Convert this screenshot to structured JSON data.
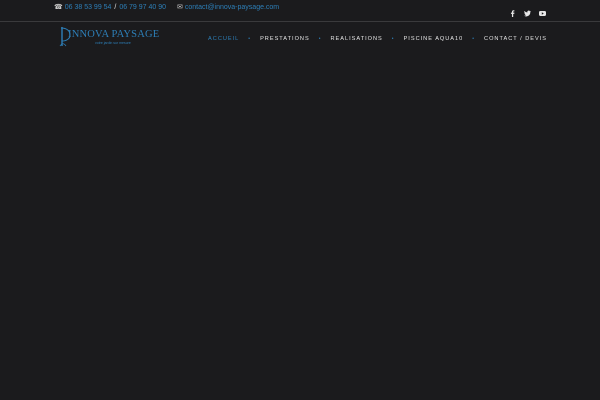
{
  "topbar": {
    "phone_icon": "phone-icon",
    "phone_1": "06 38 53 99 54",
    "phone_separator": "/",
    "phone_2": "06 79 97 40 90",
    "email_icon": "envelope-icon",
    "email": "contact@innova-paysage.com",
    "social": [
      "facebook-icon",
      "twitter-icon",
      "youtube-icon"
    ]
  },
  "header": {
    "logo_text": "INNOVA PAYSAGE",
    "logo_tagline": "votre jardin sur mesure",
    "nav": [
      {
        "label": "Accueil",
        "active": true
      },
      {
        "label": "Prestations",
        "active": false
      },
      {
        "label": "Realisations",
        "active": false
      },
      {
        "label": "Piscine Aqua10",
        "active": false
      },
      {
        "label": "Contact / Devis",
        "active": false
      }
    ],
    "nav_separator": "•"
  },
  "colors": {
    "background": "#1b1b1d",
    "accent": "#2d7fb8",
    "nav_text": "#e8e8e8",
    "divider": "#3a3a3c"
  }
}
